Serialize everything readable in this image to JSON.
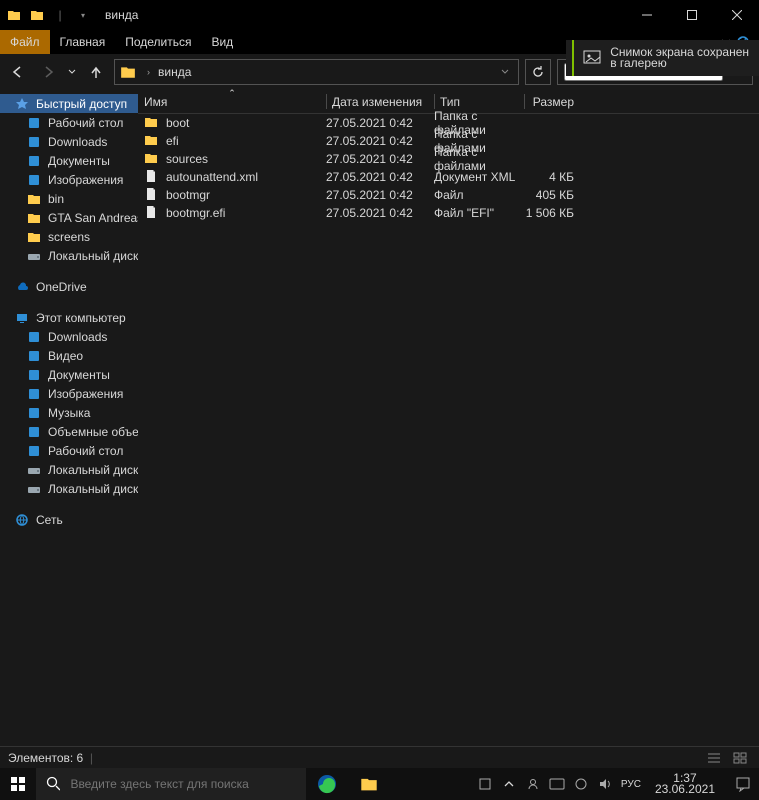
{
  "window": {
    "title": "винда"
  },
  "tabs": {
    "file": "Файл",
    "home": "Главная",
    "share": "Поделиться",
    "view": "Вид"
  },
  "breadcrumb": {
    "root_icon": "folder",
    "item": "винда"
  },
  "search": {
    "placeholder": ""
  },
  "sidebar": {
    "quick_access": "Быстрый доступ",
    "qa_items": [
      {
        "label": "Рабочий стол",
        "icon": "desktop",
        "color": "#2f8fd6"
      },
      {
        "label": "Downloads",
        "icon": "download",
        "color": "#2f8fd6"
      },
      {
        "label": "Документы",
        "icon": "doc",
        "color": "#2f8fd6"
      },
      {
        "label": "Изображения",
        "icon": "image",
        "color": "#2f8fd6"
      },
      {
        "label": "bin",
        "icon": "folder",
        "color": "#ffcc4d"
      },
      {
        "label": "GTA San Andreas",
        "icon": "folder",
        "color": "#ffcc4d"
      },
      {
        "label": "screens",
        "icon": "folder",
        "color": "#ffcc4d"
      },
      {
        "label": "Локальный диск (D:)",
        "icon": "drive",
        "color": "#9aa7b0"
      }
    ],
    "onedrive": "OneDrive",
    "thispc": "Этот компьютер",
    "pc_items": [
      {
        "label": "Downloads",
        "icon": "download",
        "color": "#2f8fd6"
      },
      {
        "label": "Видео",
        "icon": "video",
        "color": "#2f8fd6"
      },
      {
        "label": "Документы",
        "icon": "doc",
        "color": "#2f8fd6"
      },
      {
        "label": "Изображения",
        "icon": "image",
        "color": "#2f8fd6"
      },
      {
        "label": "Музыка",
        "icon": "music",
        "color": "#2f8fd6"
      },
      {
        "label": "Объемные объекты",
        "icon": "3d",
        "color": "#2f8fd6"
      },
      {
        "label": "Рабочий стол",
        "icon": "desktop",
        "color": "#2f8fd6"
      },
      {
        "label": "Локальный диск (C:)",
        "icon": "drive",
        "color": "#9aa7b0"
      },
      {
        "label": "Локальный диск (D:)",
        "icon": "drive",
        "color": "#9aa7b0"
      }
    ],
    "network": "Сеть"
  },
  "columns": {
    "name": "Имя",
    "date": "Дата изменения",
    "type": "Тип",
    "size": "Размер"
  },
  "files": [
    {
      "icon": "folder",
      "name": "boot",
      "date": "27.05.2021 0:42",
      "type": "Папка с файлами",
      "size": ""
    },
    {
      "icon": "folder",
      "name": "efi",
      "date": "27.05.2021 0:42",
      "type": "Папка с файлами",
      "size": ""
    },
    {
      "icon": "folder",
      "name": "sources",
      "date": "27.05.2021 0:42",
      "type": "Папка с файлами",
      "size": ""
    },
    {
      "icon": "file",
      "name": "autounattend.xml",
      "date": "27.05.2021 0:42",
      "type": "Документ XML",
      "size": "4 КБ"
    },
    {
      "icon": "file",
      "name": "bootmgr",
      "date": "27.05.2021 0:42",
      "type": "Файл",
      "size": "405 КБ"
    },
    {
      "icon": "file",
      "name": "bootmgr.efi",
      "date": "27.05.2021 0:42",
      "type": "Файл \"EFI\"",
      "size": "1 506 КБ"
    }
  ],
  "status": {
    "count_label": "Элементов: 6"
  },
  "taskbar": {
    "search_placeholder": "Введите здесь текст для поиска",
    "lang": "РУС"
  },
  "clock": {
    "time": "1:37",
    "date": "23.06.2021"
  },
  "toast": {
    "line1": "Снимок экрана сохранен",
    "line2": "в галерею"
  }
}
